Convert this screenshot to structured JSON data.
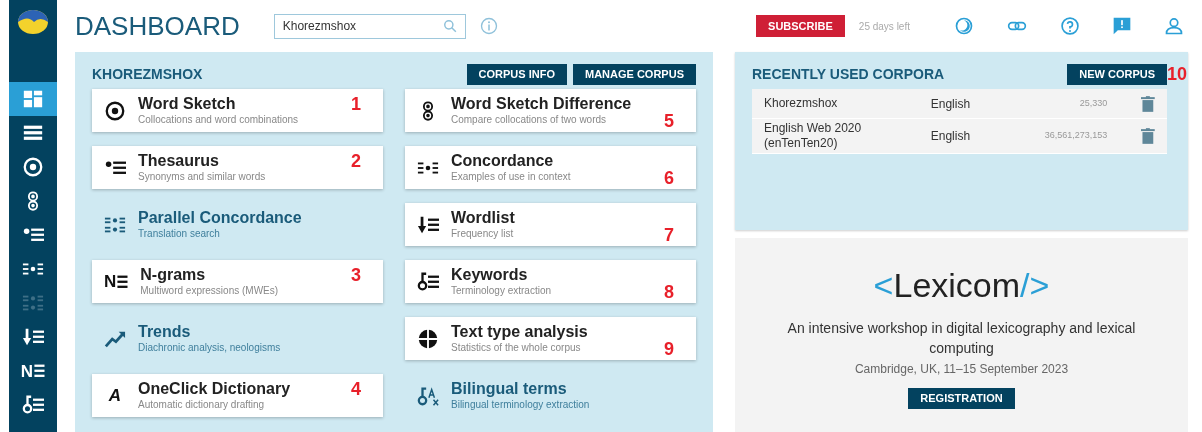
{
  "sidebar": {
    "items": [
      {
        "selected": true,
        "disabled": false
      },
      {
        "selected": false,
        "disabled": false
      },
      {
        "selected": false,
        "disabled": false
      },
      {
        "selected": false,
        "disabled": false
      },
      {
        "selected": false,
        "disabled": false
      },
      {
        "selected": false,
        "disabled": false
      },
      {
        "selected": false,
        "disabled": true
      },
      {
        "selected": false,
        "disabled": false
      },
      {
        "selected": false,
        "disabled": false,
        "glyph": "N"
      },
      {
        "selected": false,
        "disabled": false
      }
    ]
  },
  "header": {
    "title": "DASHBOARD",
    "search": {
      "value": "Khorezmshox"
    },
    "subscribe": "SUBSCRIBE",
    "trial": "25 days left"
  },
  "corpus_panel": {
    "title": "KHOREZMSHOX",
    "buttons": [
      "CORPUS INFO",
      "MANAGE CORPUS"
    ],
    "left_column": [
      {
        "title": "Word Sketch",
        "subtitle": "Collocations and word combinations",
        "boxed": true,
        "marker": "1"
      },
      {
        "title": "Thesaurus",
        "subtitle": "Synonyms and similar words",
        "boxed": true,
        "marker": "2"
      },
      {
        "title": "Parallel Concordance",
        "subtitle": "Translation search",
        "boxed": false
      },
      {
        "title": "N-grams",
        "subtitle": "Multiword expressions (MWEs)",
        "boxed": true,
        "marker": "3",
        "glyph": "N"
      },
      {
        "title": "Trends",
        "subtitle": "Diachronic analysis, neologisms",
        "boxed": false
      },
      {
        "title": "OneClick Dictionary",
        "subtitle": "Automatic dictionary drafting",
        "boxed": true,
        "marker": "4",
        "glyph": "A"
      }
    ],
    "right_column": [
      {
        "title": "Word Sketch Difference",
        "subtitle": "Compare collocations of two words",
        "boxed": true,
        "marker": "5"
      },
      {
        "title": "Concordance",
        "subtitle": "Examples of use in context",
        "boxed": true,
        "marker": "6"
      },
      {
        "title": "Wordlist",
        "subtitle": "Frequency list",
        "boxed": true,
        "marker": "7"
      },
      {
        "title": "Keywords",
        "subtitle": "Terminology extraction",
        "boxed": true,
        "marker": "8"
      },
      {
        "title": "Text type analysis",
        "subtitle": "Statistics of the whole corpus",
        "boxed": true,
        "marker": "9"
      },
      {
        "title": "Bilingual terms",
        "subtitle": "Bilingual terminology extraction",
        "boxed": false
      }
    ]
  },
  "recent_panel": {
    "title": "RECENTLY USED CORPORA",
    "button": "NEW CORPUS",
    "marker": "10",
    "rows": [
      {
        "name": "Khorezmshox",
        "language": "English",
        "size": "25,330"
      },
      {
        "name": "English Web 2020 (enTenTen20)",
        "language": "English",
        "size": "36,561,273,153"
      }
    ]
  },
  "promo": {
    "logo_open": "<",
    "logo": "Lexicom",
    "logo_close": "/>",
    "text": "An intensive workshop in digital lexicography and lexical computing",
    "details": "Cambridge, UK, 11–15 September 2023",
    "button": "REGISTRATION"
  }
}
